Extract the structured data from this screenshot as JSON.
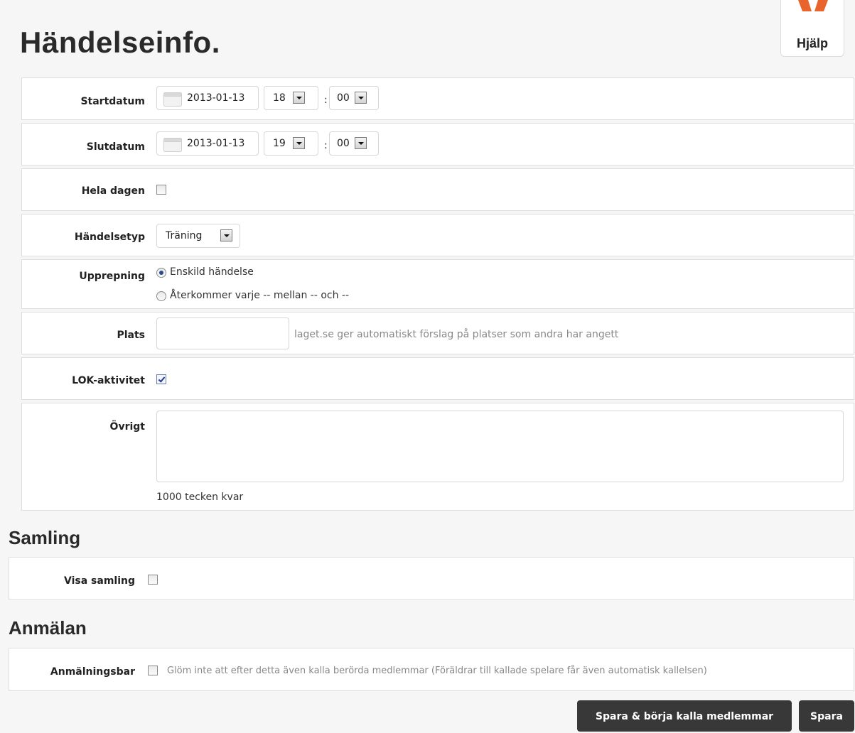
{
  "page": {
    "title": "Händelseinfo."
  },
  "help": {
    "label": "Hjälp"
  },
  "form": {
    "start": {
      "label": "Startdatum",
      "date": "2013-01-13",
      "hour": "18",
      "minute": "00"
    },
    "end": {
      "label": "Slutdatum",
      "date": "2013-01-13",
      "hour": "19",
      "minute": "00"
    },
    "time_separator": ":",
    "all_day": {
      "label": "Hela dagen",
      "checked": false
    },
    "event_type": {
      "label": "Händelsetyp",
      "value": "Träning"
    },
    "repetition": {
      "label": "Upprepning",
      "options": [
        {
          "label": "Enskild händelse",
          "selected": true
        },
        {
          "label": "Återkommer varje -- mellan -- och --",
          "selected": false
        }
      ]
    },
    "place": {
      "label": "Plats",
      "value": "",
      "hint": "laget.se ger automatiskt förslag på platser som andra har angett"
    },
    "lok": {
      "label": "LOK-aktivitet",
      "checked": true
    },
    "other": {
      "label": "Övrigt",
      "value": "",
      "counter": "1000 tecken kvar"
    }
  },
  "samling": {
    "title": "Samling",
    "show": {
      "label": "Visa samling",
      "checked": false
    }
  },
  "anmalan": {
    "title": "Anmälan",
    "registrable": {
      "label": "Anmälningsbar",
      "checked": false,
      "note": "Glöm inte att efter detta även kalla berörda medlemmar (Föräldrar till kallade spelare får även automatisk kallelsen)"
    }
  },
  "actions": {
    "save_and_call": "Spara & börja kalla medlemmar",
    "save": "Spara"
  },
  "colors": {
    "button_bg": "#383838",
    "logo_orange": "#e8642c",
    "hint_text": "#888888"
  },
  "icons": [
    "calendar-icon",
    "dropdown-arrow-icon",
    "resize-grip-icon",
    "help-logo-icon"
  ]
}
